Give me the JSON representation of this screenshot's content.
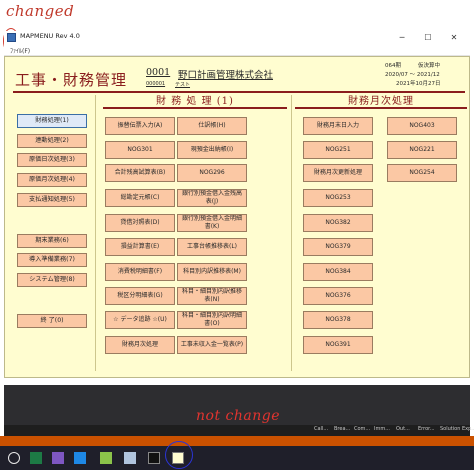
{
  "annotations": {
    "changed": "changed",
    "not_change": "not change"
  },
  "window": {
    "title": "MAPMENU  Rev  4.0",
    "min": "─",
    "max": "☐",
    "close": "✕"
  },
  "menu": {
    "file": "ﾌｧｲﾙ(F)"
  },
  "header": {
    "title": "工事・財務管理",
    "company_code": "0001",
    "company_name": "野口計画管理株式会社",
    "sub_code": "000001",
    "sub_name": "テスト",
    "period_label": "064期",
    "status": "仮決算中",
    "period_range": "2020/07 ～ 2021/12",
    "date": "2021年10月27日"
  },
  "sections": {
    "finance": "財 務 処 理 (1)",
    "monthly": "財務月次処理"
  },
  "sidebar": [
    {
      "label": "財務処理(1)",
      "active": true
    },
    {
      "label": "連動処理(2)"
    },
    {
      "label": "原価日次処理(3)"
    },
    {
      "label": "原価月次処理(4)"
    },
    {
      "label": "支払通知処理(5)"
    },
    {
      "label": "期末業務(6)"
    },
    {
      "label": "導入準備業務(7)"
    },
    {
      "label": "システム管理(8)"
    },
    {
      "label": "終  了(0)"
    }
  ],
  "finance_buttons": [
    [
      "振替伝票入力(A)",
      "仕訳帳(H)"
    ],
    [
      "NOG301",
      "現預金出納帳(I)"
    ],
    [
      "合計残高試算表(B)",
      "NOG296"
    ],
    [
      "総勘定元帳(C)",
      "銀行別預金借入金残高表(J)"
    ],
    [
      "貸借対照表(D)",
      "銀行別預金借入金明細書(K)"
    ],
    [
      "損益計算書(E)",
      "工事台帳推移表(L)"
    ],
    [
      "消費税明細書(F)",
      "科目別内訳推移表(M)"
    ],
    [
      "税区分明細表(G)",
      "科目・細目別内訳推移表(N)"
    ],
    [
      "☆ データ追跡 ☆(U)",
      "科目・細目別内訳明細書(O)"
    ],
    [
      "財務月次処理",
      "工事未収入金一覧表(P)"
    ]
  ],
  "monthly_buttons": [
    [
      "財務月末日入力",
      "NOG403"
    ],
    [
      "NOG251",
      "NOG221"
    ],
    [
      "財務月次更新処理",
      "NOG254"
    ],
    [
      "NOG253"
    ],
    [
      "NOG382"
    ],
    [
      "NOG379"
    ],
    [
      "NOG384"
    ],
    [
      "NOG376"
    ],
    [
      "NOG378"
    ],
    [
      "NOG391"
    ]
  ],
  "ide_tabs": [
    "Call...",
    "Brea...",
    "Com...",
    "Imm...",
    "Out...",
    "Error...",
    "Solution Exp..."
  ],
  "taskbar_icons": [
    "search-icon",
    "excel-icon",
    "visual-studio-icon",
    "vs-code-icon",
    "notepad-icon",
    "document-icon",
    "terminal-icon",
    "mapmenu-icon"
  ]
}
